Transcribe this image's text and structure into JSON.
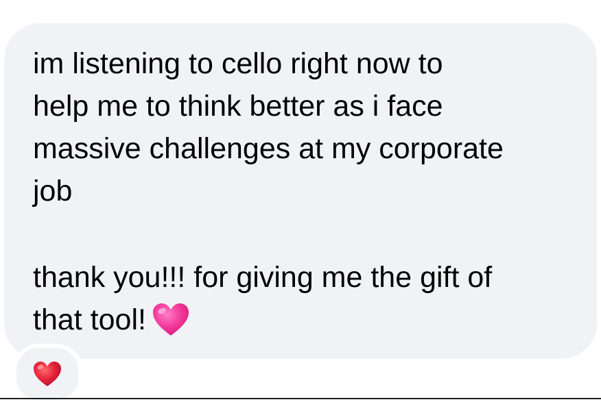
{
  "message": {
    "lines": [
      "im listening to cello right now to",
      "help me to think better as i face",
      "massive challenges at my corporate",
      "job",
      "thank you!!! for giving me the gift of",
      "that tool!"
    ],
    "emoji": "pink-heart-icon"
  },
  "reaction": {
    "emoji": "red-heart-icon",
    "color": "#e3223a"
  },
  "colors": {
    "bubble": "#f1f2f6",
    "text": "#000000",
    "pink_heart": "#f23a9b"
  }
}
